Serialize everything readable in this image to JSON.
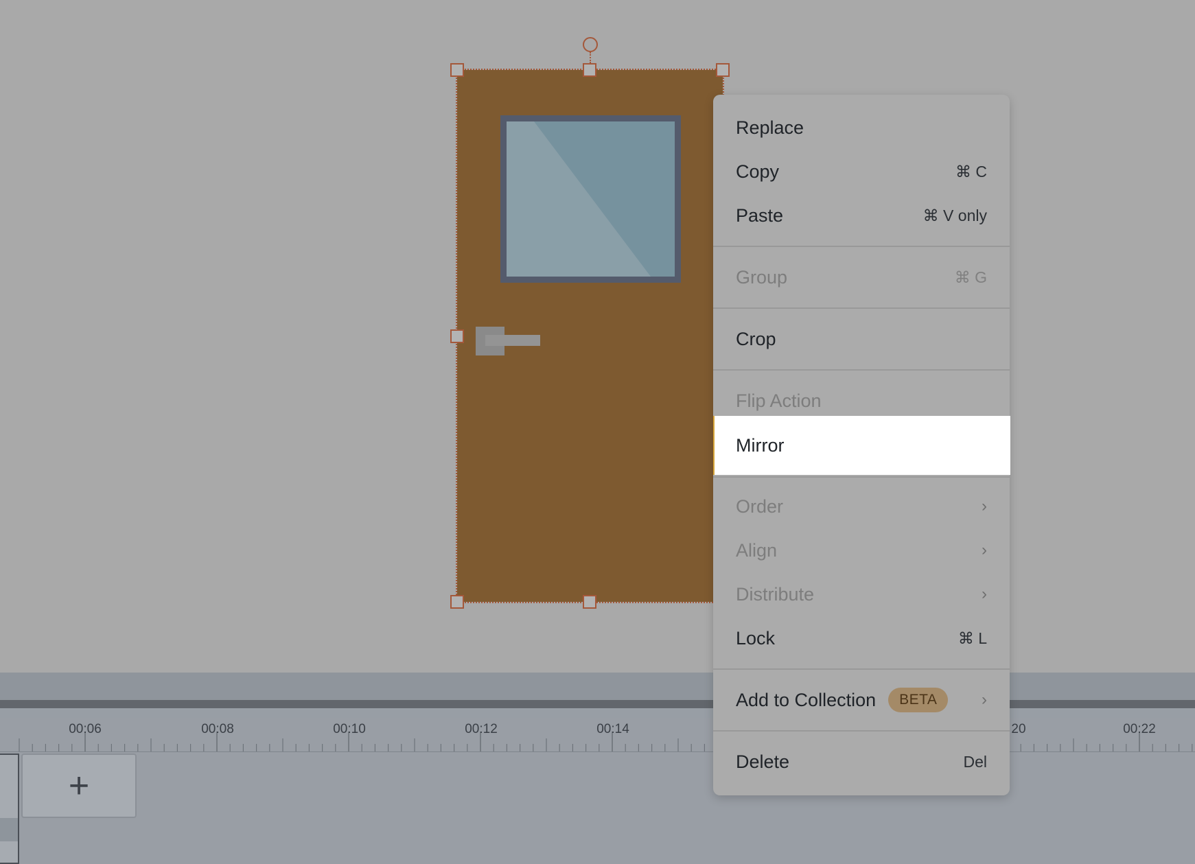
{
  "timeline": {
    "ruler_labels": [
      "00:06",
      "00:08",
      "00:10",
      "00:12",
      "00:14",
      "20",
      "00:22"
    ],
    "add_scene_symbol": "+"
  },
  "context_menu": {
    "items": [
      {
        "label": "Replace",
        "shortcut": "",
        "disabled": false
      },
      {
        "label": "Copy",
        "shortcut": "⌘ C",
        "disabled": false
      },
      {
        "label": "Paste",
        "shortcut": "⌘ V only",
        "disabled": false
      },
      {
        "label": "Group",
        "shortcut": "⌘ G",
        "disabled": true
      },
      {
        "label": "Crop",
        "shortcut": "",
        "disabled": false
      },
      {
        "label": "Flip Action",
        "shortcut": "",
        "disabled": true
      },
      {
        "label": "Mirror",
        "shortcut": "",
        "disabled": false,
        "highlighted": true
      },
      {
        "label": "Order",
        "chevron": "›",
        "disabled": true
      },
      {
        "label": "Align",
        "chevron": "›",
        "disabled": true
      },
      {
        "label": "Distribute",
        "chevron": "›",
        "disabled": true
      },
      {
        "label": "Lock",
        "shortcut": "⌘ L",
        "disabled": false
      },
      {
        "label": "Add to Collection",
        "badge": "BETA",
        "chevron": "›",
        "disabled": false
      },
      {
        "label": "Delete",
        "shortcut": "Del",
        "disabled": false
      }
    ]
  },
  "colors": {
    "canvas_background": "#a9a9a9",
    "door": "#7e5a30",
    "selection": "#a4583a",
    "highlight": "#ffffff",
    "beta_badge": "#a48a67"
  }
}
